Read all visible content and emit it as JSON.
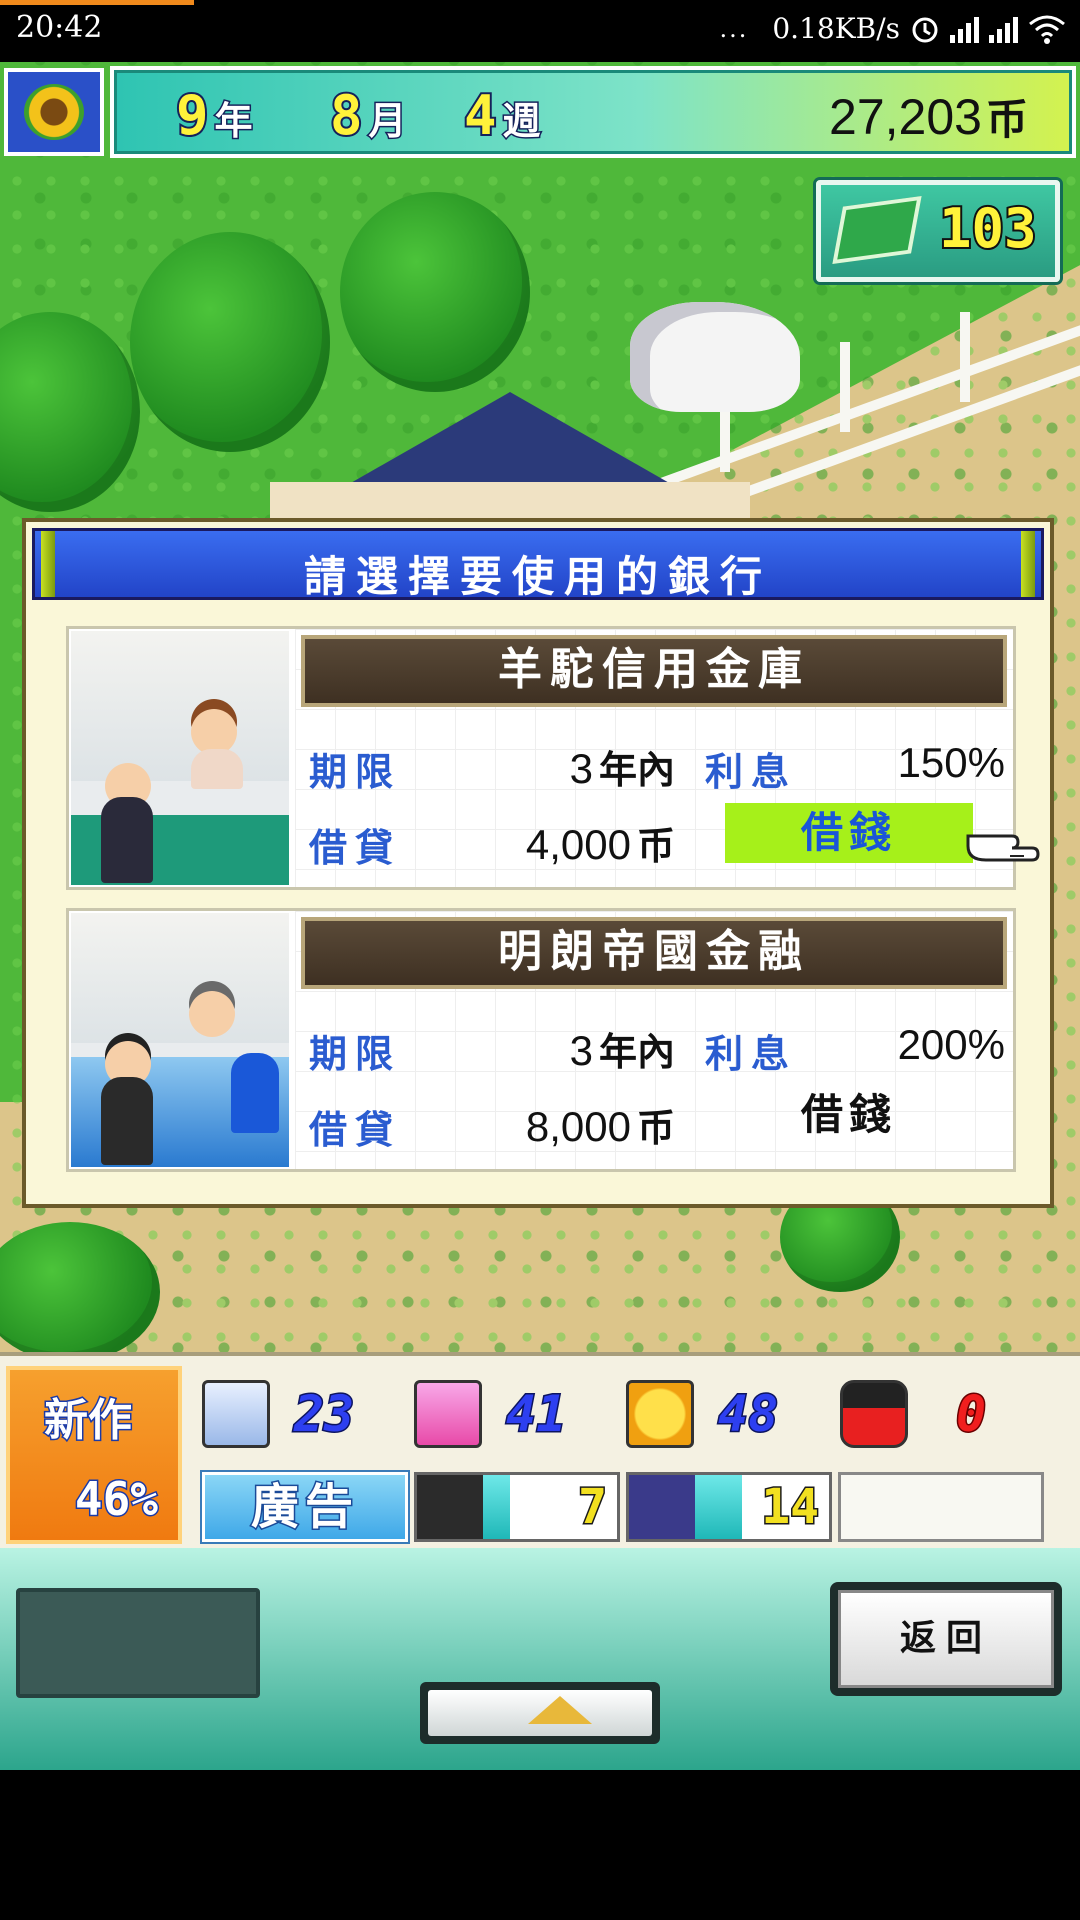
{
  "status_bar": {
    "time": "20:42",
    "more": "...",
    "net_speed": "0.18KB/s",
    "icons": [
      "alarm-icon",
      "hd-signal-icon",
      "signal-icon",
      "wifi-icon"
    ]
  },
  "top_hud": {
    "year_num": "9",
    "year_unit": "年",
    "month_num": "8",
    "month_unit": "月",
    "week_num": "4",
    "week_unit": "週",
    "money": "27,203",
    "currency": "币",
    "books": "103"
  },
  "dialog": {
    "title": "請選擇要使用的銀行",
    "banks": [
      {
        "name": "羊駝信用金庫",
        "term_label": "期限",
        "term_value": "3",
        "term_unit": "年內",
        "interest_label": "利息",
        "interest_value": "150%",
        "loan_label": "借貸",
        "loan_value": "4,000",
        "loan_unit": "币",
        "button": "借錢"
      },
      {
        "name": "明朗帝國金融",
        "term_label": "期限",
        "term_value": "3",
        "term_unit": "年內",
        "interest_label": "利息",
        "interest_value": "200%",
        "loan_label": "借貸",
        "loan_value": "8,000",
        "loan_unit": "币",
        "button": "借錢"
      }
    ]
  },
  "bottom_hud": {
    "new_work_label": "新作",
    "new_work_pct": "46%",
    "stat1": "23",
    "stat2": "41",
    "stat3": "48",
    "stat4": "0",
    "ad_label": "廣告",
    "staff1": "7",
    "staff1_fill": 0.2,
    "staff2": "14",
    "staff2_fill": 0.35
  },
  "nav": {
    "back_label": "返回"
  },
  "colors": {
    "accent_blue": "#2a5cd0",
    "borrow_active": "#a6f01a",
    "grass": "#4fb83a"
  }
}
